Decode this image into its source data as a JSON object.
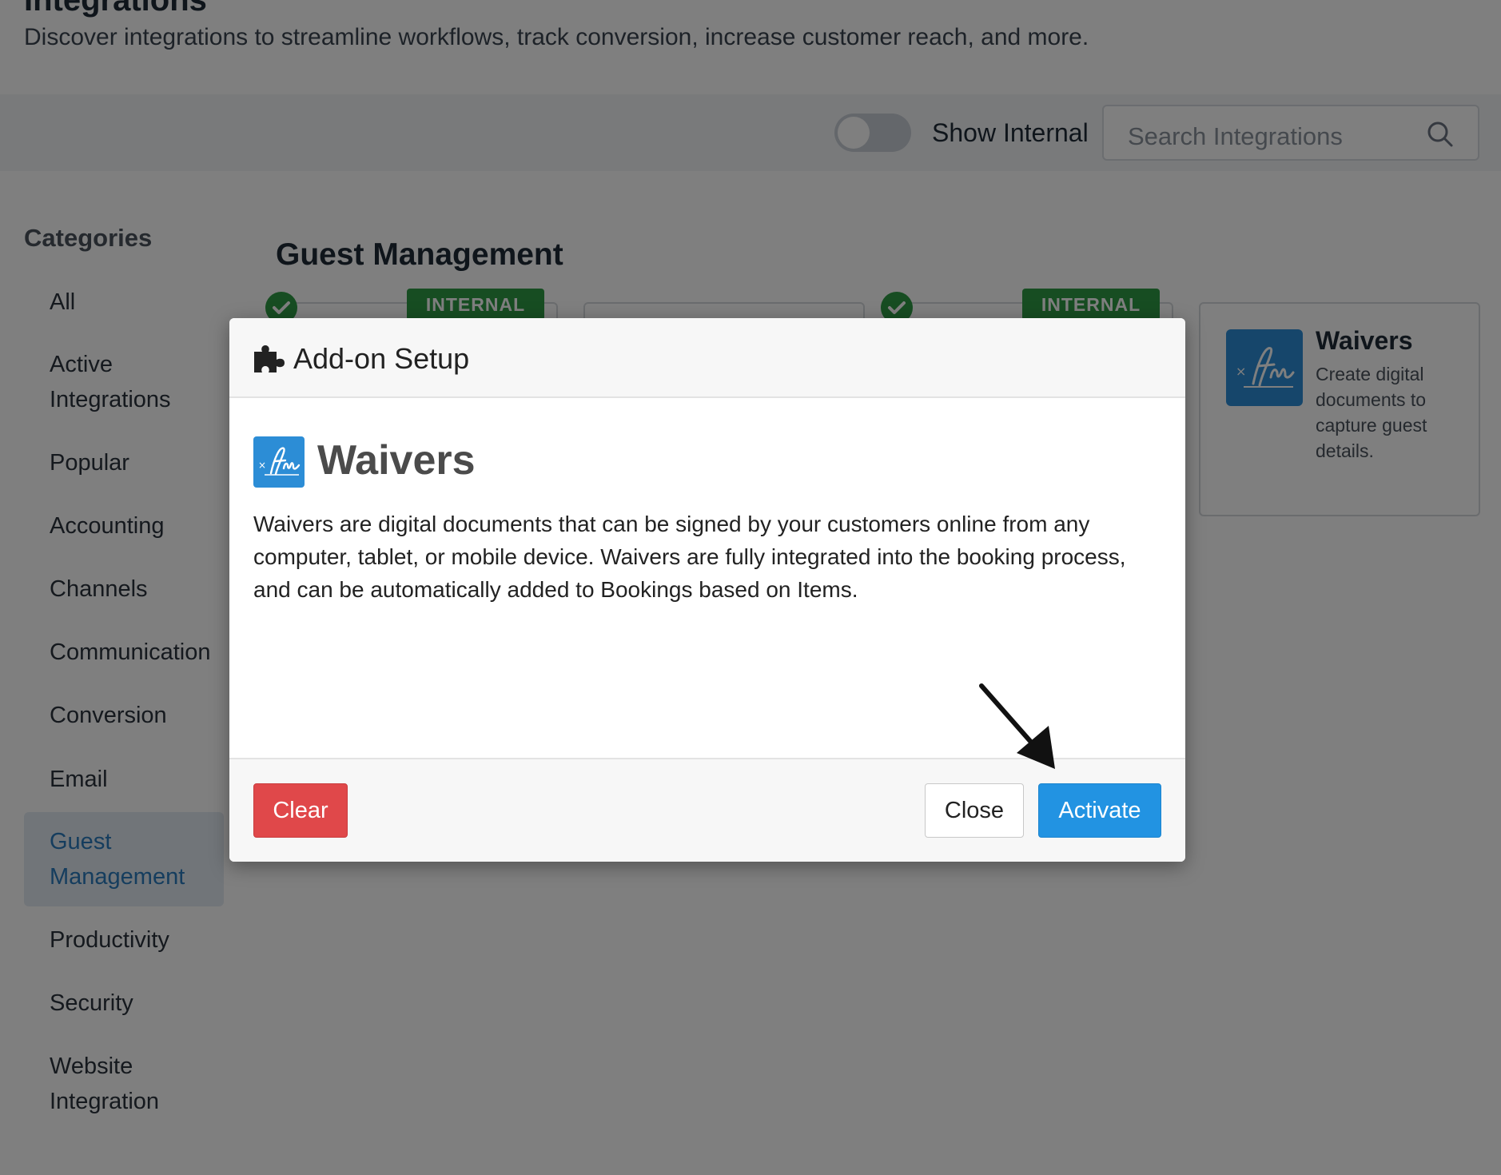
{
  "page": {
    "title": "Integrations",
    "subtitle": "Discover integrations to streamline workflows, track conversion, increase customer reach, and more."
  },
  "toolbar": {
    "toggle_label": "Show Internal",
    "search_placeholder": "Search Integrations"
  },
  "sidebar": {
    "heading": "Categories",
    "items": [
      {
        "label": "All"
      },
      {
        "label": "Active Integrations"
      },
      {
        "label": "Popular"
      },
      {
        "label": "Accounting"
      },
      {
        "label": "Channels"
      },
      {
        "label": "Communication"
      },
      {
        "label": "Conversion"
      },
      {
        "label": "Email"
      },
      {
        "label": "Guest Management",
        "active": true
      },
      {
        "label": "Productivity"
      },
      {
        "label": "Security"
      },
      {
        "label": "Website Integration"
      }
    ]
  },
  "main": {
    "section_title": "Guest Management",
    "badge_label": "INTERNAL",
    "cards": [
      {
        "title": "",
        "description": "",
        "active": true,
        "internal": true
      },
      {
        "title": "",
        "description": "",
        "active": false,
        "internal": false
      },
      {
        "title": "",
        "description": "",
        "active": true,
        "internal": true
      },
      {
        "title": "Waivers",
        "description": "Create digital documents to capture guest details.",
        "active": false,
        "internal": false
      }
    ]
  },
  "modal": {
    "header_icon": "puzzle-icon",
    "title": "Add-on Setup",
    "addon_name": "Waivers",
    "addon_icon": "signature-icon",
    "description": "Waivers are digital documents that can be signed by your customers online from any computer, tablet, or mobile device. Waivers are fully integrated into the booking process, and can be automatically added to Bookings based on Items.",
    "clear_label": "Clear",
    "close_label": "Close",
    "activate_label": "Activate"
  },
  "colors": {
    "accent_blue": "#2293e2",
    "danger_red": "#e0484a",
    "success_green": "#2f9a44",
    "active_category": "#2b7bbd"
  }
}
